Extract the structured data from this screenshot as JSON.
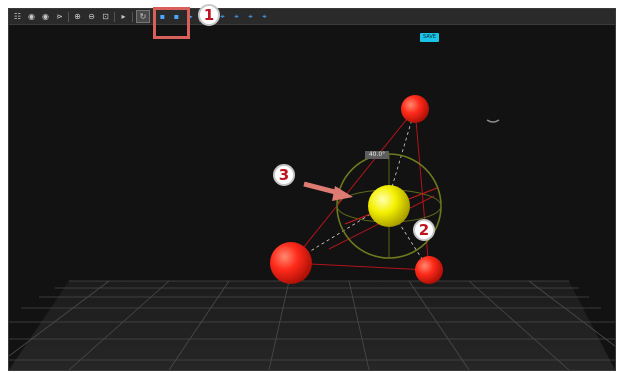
{
  "toolbar": {
    "icons": [
      "grid-icon",
      "camera-icon",
      "camera-icon",
      "hierarchy-icon",
      "zoom-in-icon",
      "zoom-out-icon",
      "zoom-fit-icon",
      "pointer-icon",
      "rotate-icon",
      "box-icon",
      "box-icon",
      "play-icon",
      "eye-icon",
      "node-add-icon",
      "node-remove-icon",
      "node-link-icon",
      "node-unlink-icon"
    ],
    "glyphs": [
      "☷",
      "◉",
      "◉",
      "⋗",
      "⊕",
      "⊖",
      "⊡",
      "▸",
      "↻",
      "▪",
      "▪",
      "▸",
      "◉",
      "⌖",
      "⌖",
      "⌖",
      "⌖"
    ]
  },
  "viewport": {
    "badge_text": "SAVE",
    "angle_label": "40.0°"
  },
  "callouts": [
    "1",
    "2",
    "3"
  ],
  "colors": {
    "background": "#121212",
    "red_sphere": "#ff2a1a",
    "yellow_sphere": "#f4f000",
    "gizmo_ring": "#6f7a1f",
    "highlight_box": "#d9605a",
    "callout_text": "#c1121f",
    "badge": "#19c4e6"
  }
}
